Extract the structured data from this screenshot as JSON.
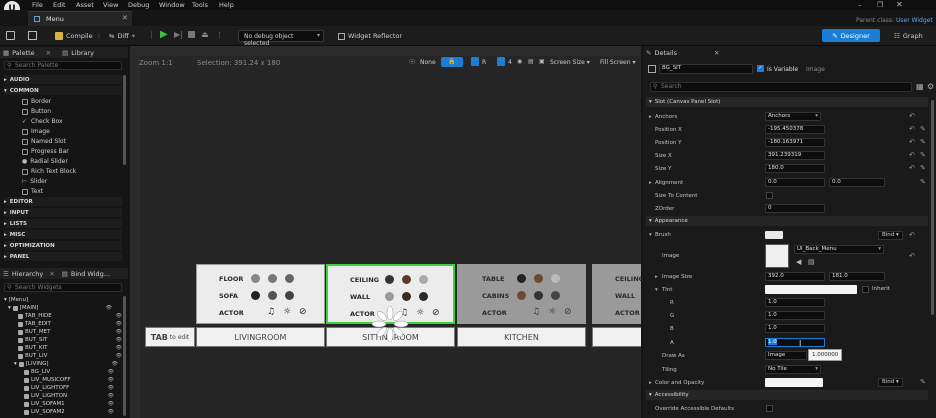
{
  "menubar": {
    "items": [
      "File",
      "Edit",
      "Asset",
      "View",
      "Debug",
      "Window",
      "Tools",
      "Help"
    ]
  },
  "window_title": "Parent class:",
  "parent_class": "User Widget",
  "tab": {
    "label": "Menu"
  },
  "toolbar": {
    "compile_label": "Compile",
    "diff_label": "Diff",
    "debug_select": "No debug object selected",
    "widget_reflector_label": "Widget Reflector",
    "designer_label": "Designer",
    "graph_label": "Graph"
  },
  "palette": {
    "tab_label": "Palette",
    "library_label": "Library",
    "search_placeholder": "Search Palette",
    "categories": [
      "AUDIO",
      "COMMON",
      "EDITOR",
      "INPUT",
      "LISTS",
      "MISC",
      "OPTIMIZATION",
      "PANEL"
    ],
    "common_items": [
      "Border",
      "Button",
      "Check Box",
      "Image",
      "Named Slot",
      "Progress Bar",
      "Radial Slider",
      "Rich Text Block",
      "Slider",
      "Text"
    ]
  },
  "hierarchy": {
    "tab_label": "Hierarchy",
    "bind_label": "Bind Widg...",
    "search_placeholder": "Search Widgets",
    "items": [
      "[Menu]",
      "[MAIN]",
      "TAB_HIDE",
      "TAB_EDIT",
      "BUT_MET",
      "BUT_SIT",
      "BUT_KIT",
      "BUT_LIV",
      "[LIVING]",
      "BG_LIV",
      "LIV_MUSICOFF",
      "LIV_LIGHTOFF",
      "LIV_LIGHTON",
      "LIV_SOFAM1",
      "LIV_SOFAM2"
    ]
  },
  "designer": {
    "zoom_text": "Zoom 1:1",
    "selection_text": "Selection: 391.24 x 180",
    "none_label": "None",
    "r_label": "R",
    "grid_value": "4",
    "screen_size_label": "Screen Size",
    "fill_screen_label": "Fill Screen",
    "tab_to_edit_bold": "TAB",
    "tab_to_edit_rest": " to edit",
    "cards": [
      {
        "rows": [
          "FLOOR",
          "SOFA",
          "ACTOR"
        ],
        "button": "LIVINGROOM"
      },
      {
        "rows": [
          "CEILING",
          "WALL",
          "ACTOR"
        ],
        "button": "SITTINGROOM"
      },
      {
        "rows": [
          "TABLE",
          "CABINS",
          "ACTOR"
        ],
        "button": "KITCHEN"
      },
      {
        "rows": [
          "CEILING",
          "WALL",
          "ACTOR"
        ],
        "button": ""
      }
    ]
  },
  "details": {
    "tab_label": "Details",
    "widget_name": "BG_SIT",
    "is_variable_label": "Is Variable",
    "image_label": "Image",
    "search_placeholder": "Search",
    "slot_section": "Slot (Canvas Panel Slot)",
    "anchors_label": "Anchors",
    "anchors_value": "Anchors",
    "position_x_label": "Position X",
    "position_x_value": "-195.450378",
    "position_y_label": "Position Y",
    "position_y_value": "-180.163971",
    "size_x_label": "Size X",
    "size_x_value": "391.239319",
    "size_y_label": "Size Y",
    "size_y_value": "180.0",
    "alignment_label": "Alignment",
    "alignment_x": "0.0",
    "alignment_y": "0.0",
    "size_to_content_label": "Size To Content",
    "zorder_label": "ZOrder",
    "zorder_value": "0",
    "appearance_section": "Appearance",
    "brush_label": "Brush",
    "bind_label": "Bind",
    "image_prop_label": "Image",
    "image_asset": "UI_Back_Menu",
    "image_size_label": "Image Size",
    "image_size_x": "392.0",
    "image_size_y": "181.0",
    "tint_label": "Tint",
    "inherit_label": "Inherit",
    "r_label": "R",
    "r_value": "1.0",
    "g_label": "G",
    "g_value": "1.0",
    "b_label": "B",
    "b_value": "1.0",
    "a_label": "A",
    "a_value": "1.0",
    "a_tooltip": "1.000000",
    "draw_as_label": "Draw As",
    "draw_as_value": "Image",
    "tiling_label": "Tiling",
    "tiling_value": "No Tile",
    "color_opacity_label": "Color and Opacity",
    "accessibility_section": "Accessibility",
    "override_accessible_label": "Override Accessible Defaults"
  },
  "colors": {
    "accent": "#1a8fe0",
    "selection_green": "#3ad23a",
    "canvas": "#262626"
  }
}
